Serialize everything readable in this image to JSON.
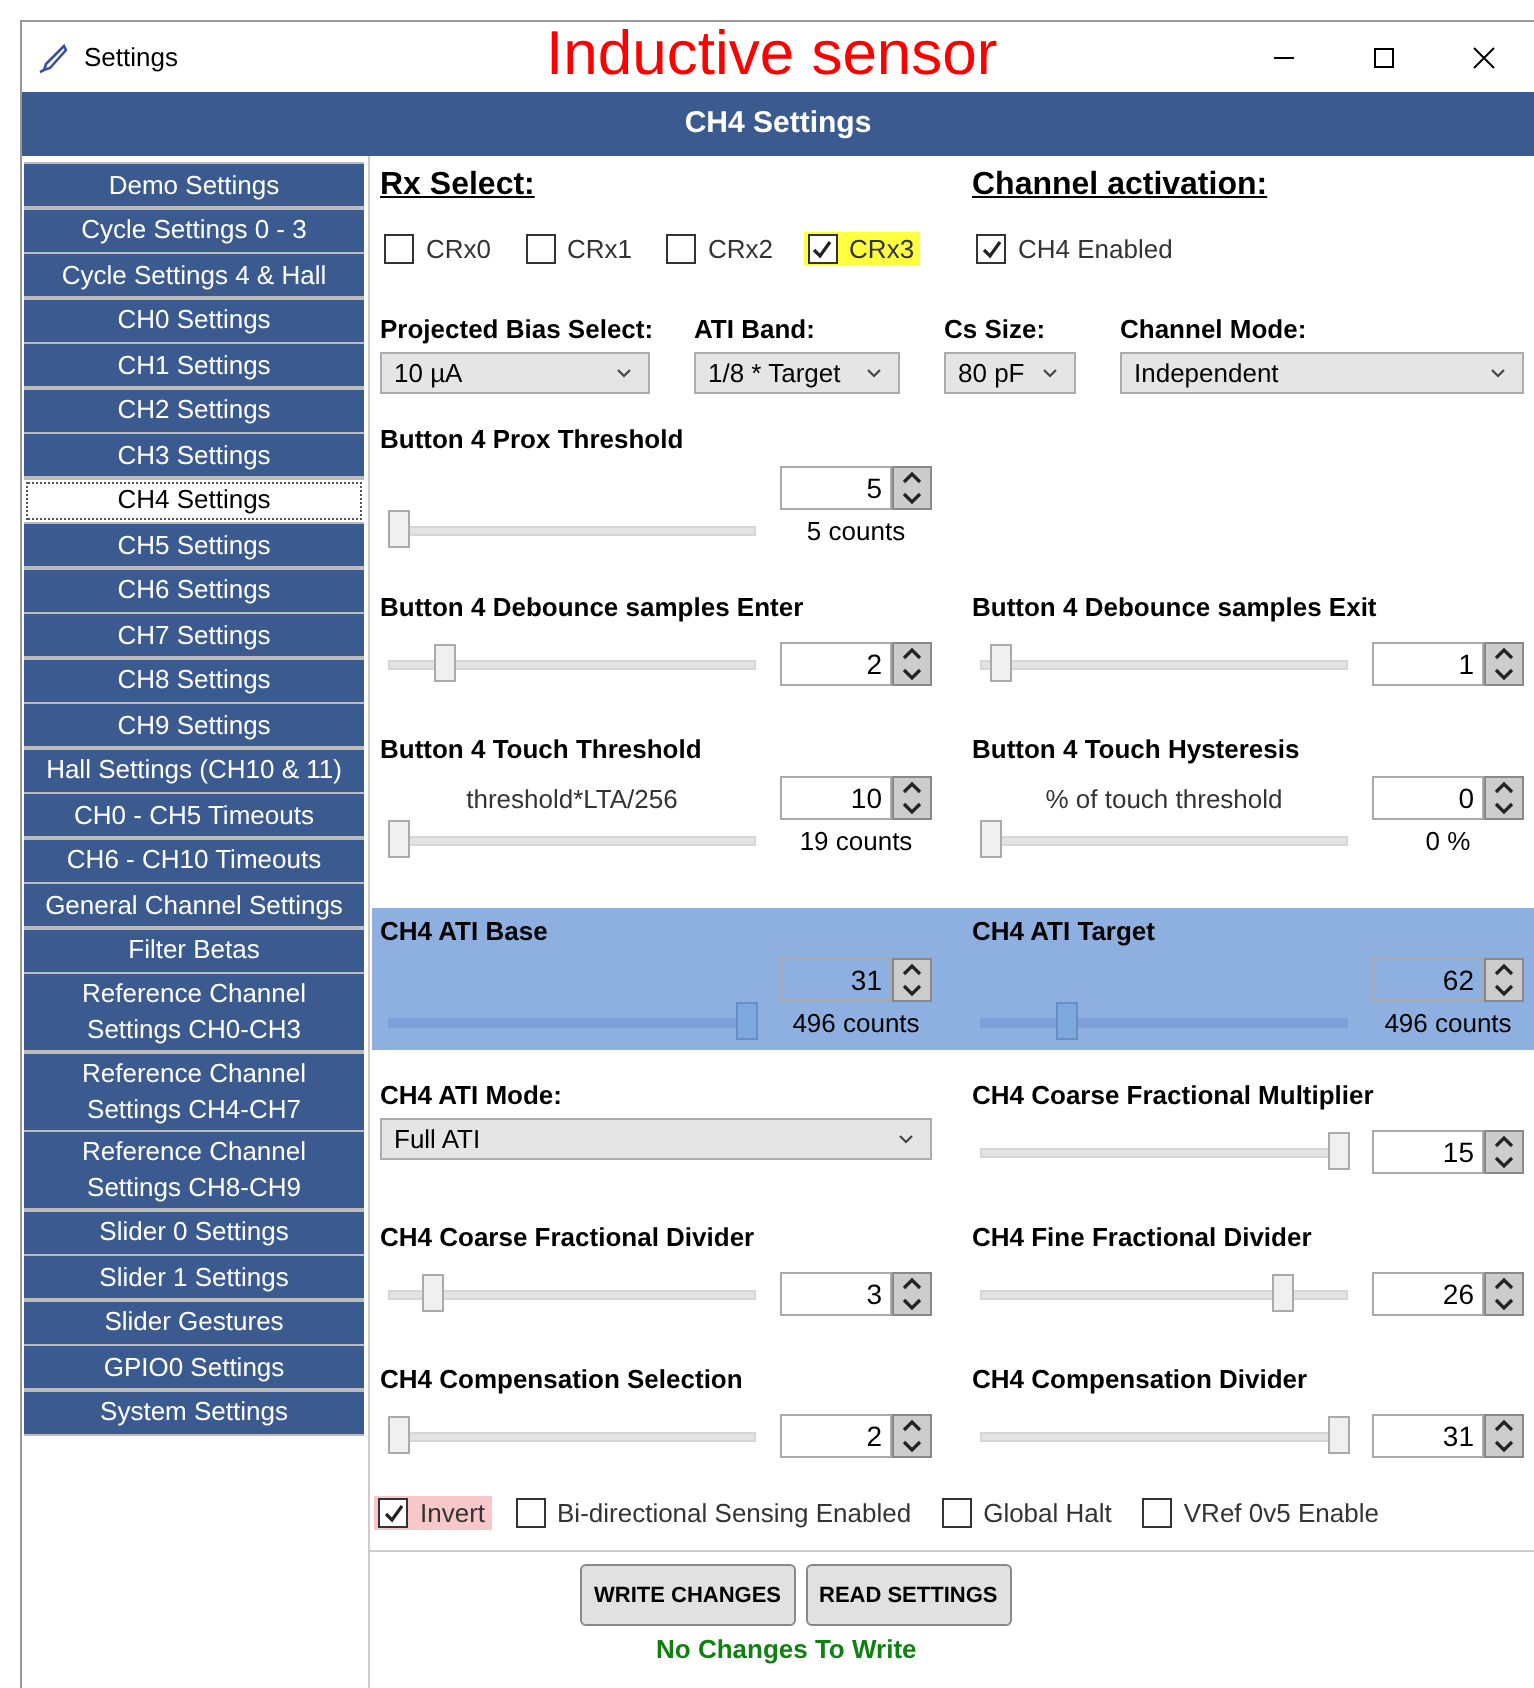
{
  "window": {
    "title": "Settings",
    "annotation": "Inductive sensor"
  },
  "header": "CH4 Settings",
  "sidebar": {
    "items": [
      {
        "label": "Demo Settings",
        "selected": false
      },
      {
        "label": "Cycle Settings 0 - 3",
        "selected": false
      },
      {
        "label": "Cycle Settings 4 & Hall",
        "selected": false
      },
      {
        "label": "CH0 Settings",
        "selected": false
      },
      {
        "label": "CH1 Settings",
        "selected": false
      },
      {
        "label": "CH2 Settings",
        "selected": false
      },
      {
        "label": "CH3 Settings",
        "selected": false
      },
      {
        "label": "CH4 Settings",
        "selected": true
      },
      {
        "label": "CH5 Settings",
        "selected": false
      },
      {
        "label": "CH6 Settings",
        "selected": false
      },
      {
        "label": "CH7 Settings",
        "selected": false
      },
      {
        "label": "CH8 Settings",
        "selected": false
      },
      {
        "label": "CH9 Settings",
        "selected": false
      },
      {
        "label": "Hall Settings (CH10 & 11)",
        "selected": false
      },
      {
        "label": "CH0 - CH5 Timeouts",
        "selected": false
      },
      {
        "label": "CH6 - CH10 Timeouts",
        "selected": false
      },
      {
        "label": "General Channel Settings",
        "selected": false
      },
      {
        "label": "Filter Betas",
        "selected": false
      },
      {
        "label": "Reference Channel\nSettings CH0-CH3",
        "selected": false
      },
      {
        "label": "Reference Channel\nSettings CH4-CH7",
        "selected": false
      },
      {
        "label": "Reference Channel\nSettings CH8-CH9",
        "selected": false
      },
      {
        "label": "Slider 0 Settings",
        "selected": false
      },
      {
        "label": "Slider 1 Settings",
        "selected": false
      },
      {
        "label": "Slider Gestures",
        "selected": false
      },
      {
        "label": "GPIO0 Settings",
        "selected": false
      },
      {
        "label": "System Settings",
        "selected": false
      }
    ]
  },
  "rx_select": {
    "heading": "Rx Select:",
    "options": [
      {
        "label": "CRx0",
        "checked": false,
        "highlighted": false
      },
      {
        "label": "CRx1",
        "checked": false,
        "highlighted": false
      },
      {
        "label": "CRx2",
        "checked": false,
        "highlighted": false
      },
      {
        "label": "CRx3",
        "checked": true,
        "highlighted": true
      }
    ]
  },
  "channel_activation": {
    "heading": "Channel activation:",
    "options": [
      {
        "label": "CH4 Enabled",
        "checked": true,
        "highlighted": false
      }
    ]
  },
  "dropdowns": [
    {
      "label": "Projected Bias Select:",
      "value": "10 µA"
    },
    {
      "label": "ATI Band:",
      "value": "1/8 * Target"
    },
    {
      "label": "Cs Size:",
      "value": "80 pF"
    },
    {
      "label": "Channel Mode:",
      "value": "Independent"
    }
  ],
  "rows": [
    {
      "highlighted": false,
      "controls": [
        {
          "kind": "slider",
          "label": "Button 4 Prox Threshold",
          "value": "5",
          "level": 0,
          "reading": "5 counts"
        }
      ]
    },
    {
      "highlighted": false,
      "controls": [
        {
          "kind": "slider",
          "label": "Button 4 Debounce samples Enter",
          "value": "2",
          "level": 0.13
        },
        {
          "kind": "slider",
          "label": "Button 4 Debounce samples Exit",
          "value": "1",
          "level": 0.03
        }
      ]
    },
    {
      "highlighted": false,
      "controls": [
        {
          "kind": "slider",
          "label": "Button 4 Touch Threshold",
          "note": "threshold*LTA/256",
          "value": "10",
          "level": 0,
          "reading": "19 counts"
        },
        {
          "kind": "slider",
          "label": "Button 4 Touch Hysteresis",
          "note": "% of touch threshold",
          "value": "0",
          "level": 0,
          "reading": "0 %"
        }
      ]
    },
    {
      "highlighted": true,
      "controls": [
        {
          "kind": "slider",
          "label": "CH4 ATI Base",
          "value": "31",
          "level": 1,
          "reading": "496 counts"
        },
        {
          "kind": "slider",
          "label": "CH4 ATI Target",
          "value": "62",
          "level": 0.22,
          "reading": "496 counts"
        }
      ]
    },
    {
      "highlighted": false,
      "controls": [
        {
          "kind": "dropdown",
          "label": "CH4 ATI Mode:",
          "value": "Full ATI"
        },
        {
          "kind": "slider",
          "label": "CH4 Coarse Fractional Multiplier",
          "value": "15",
          "level": 1
        }
      ]
    },
    {
      "highlighted": false,
      "controls": [
        {
          "kind": "slider",
          "label": "CH4 Coarse Fractional Divider",
          "value": "3",
          "level": 0.1
        },
        {
          "kind": "slider",
          "label": "CH4 Fine Fractional Divider",
          "value": "26",
          "level": 0.84
        }
      ]
    },
    {
      "highlighted": false,
      "controls": [
        {
          "kind": "slider",
          "label": "CH4 Compensation Selection",
          "value": "2",
          "level": 0
        },
        {
          "kind": "slider",
          "label": "CH4 Compensation Divider",
          "value": "31",
          "level": 1
        }
      ]
    }
  ],
  "options": [
    {
      "label": "Invert",
      "checked": true,
      "highlighted": true
    },
    {
      "label": "Bi-directional Sensing Enabled",
      "checked": false,
      "highlighted": false
    },
    {
      "label": "Global Halt",
      "checked": false,
      "highlighted": false
    },
    {
      "label": "VRef 0v5 Enable",
      "checked": false,
      "highlighted": false
    }
  ],
  "buttons": [
    "WRITE CHANGES",
    "READ SETTINGS"
  ],
  "status": "No Changes To Write"
}
